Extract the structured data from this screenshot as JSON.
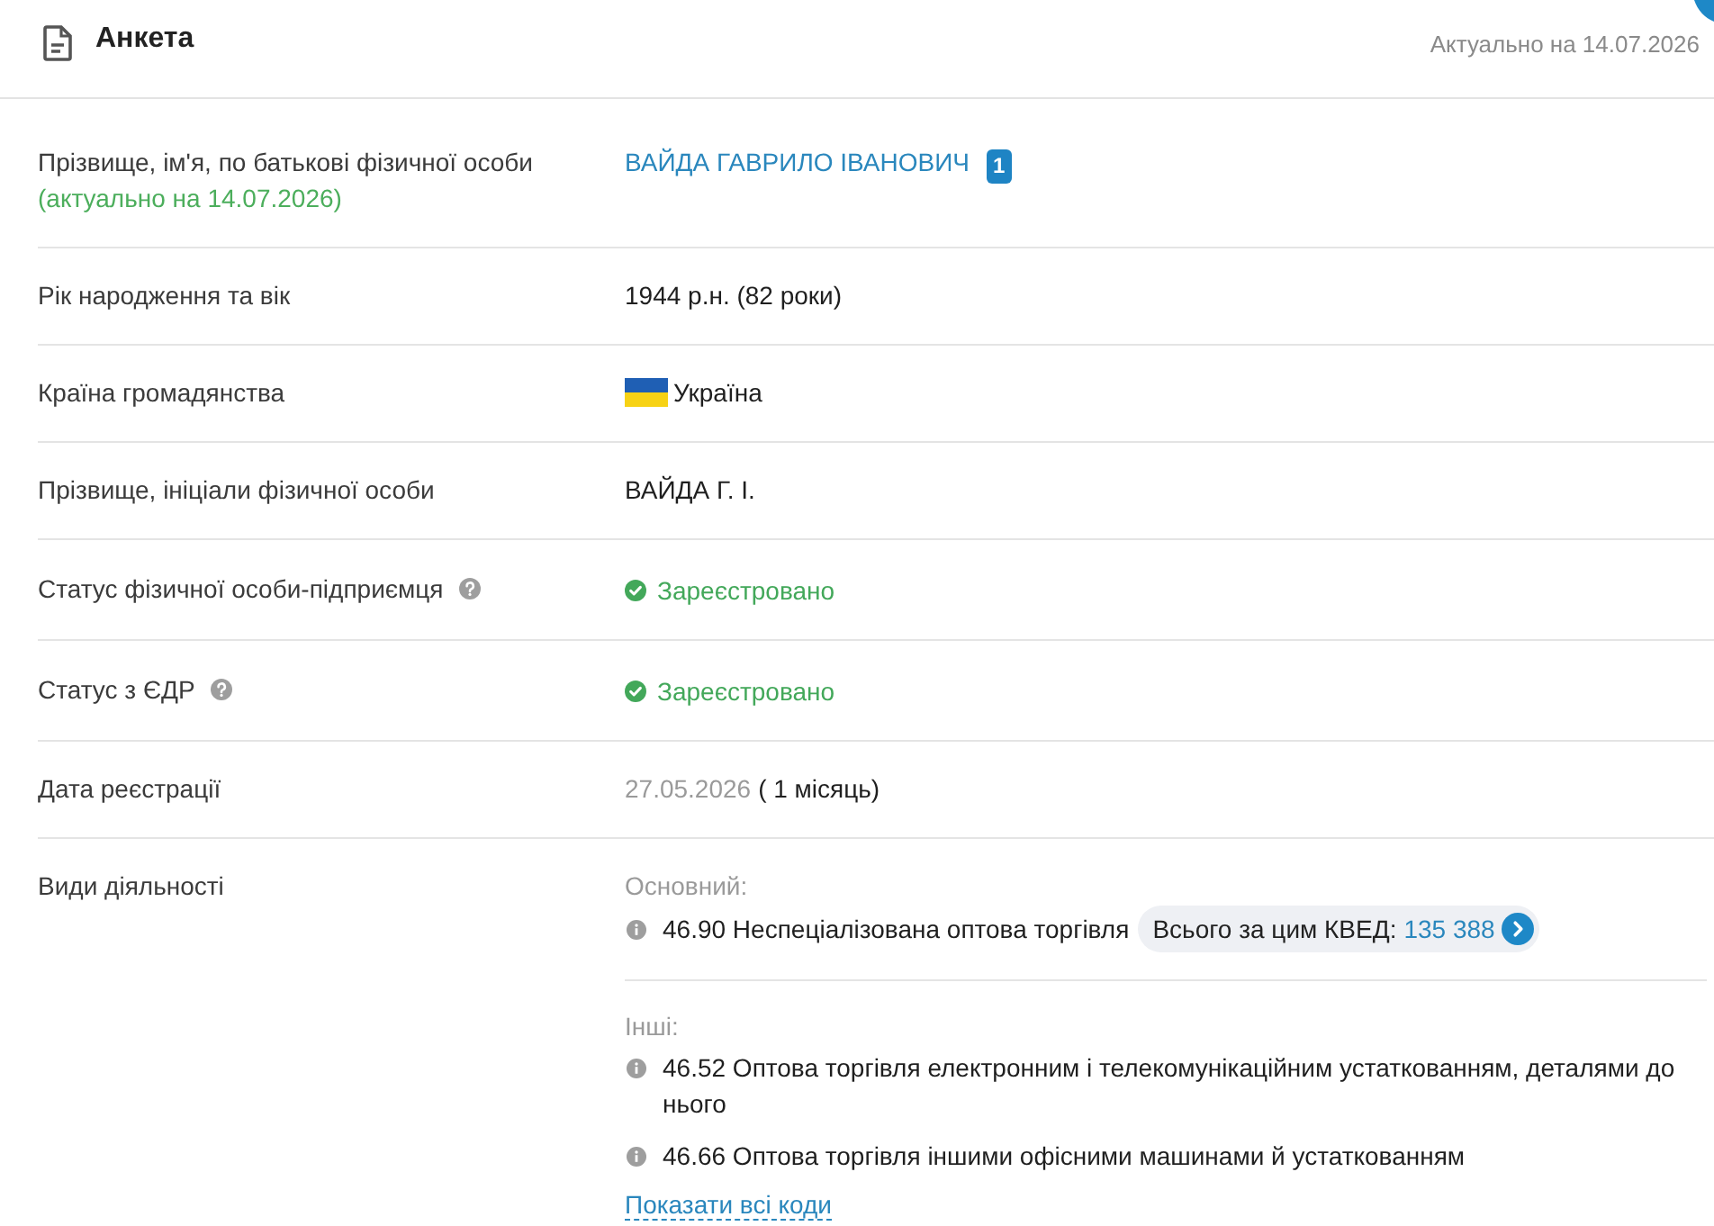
{
  "header": {
    "title": "Анкета",
    "updated": "Актуально на 14.07.2026"
  },
  "rows": [
    {
      "kind": "name",
      "label": "Прізвище, ім'я, по батькові фізичної особи",
      "note": "(актуально на 14.07.2026)",
      "value": "ВАЙДА ГАВРИЛО ІВАНОВИЧ",
      "badge": "1",
      "help": false
    },
    {
      "kind": "text",
      "label": "Рік народження та вік",
      "value": "1944 р.н. (82 роки)",
      "help": false
    },
    {
      "kind": "country",
      "label": "Країна громадянства",
      "value": "Україна",
      "help": false
    },
    {
      "kind": "text",
      "label": "Прізвище, ініціали фізичної особи",
      "value": "ВАЙДА Г. І.",
      "help": false
    },
    {
      "kind": "status",
      "label": "Статус фізичної особи-підприємця",
      "value": "Зареєстровано",
      "help": true
    },
    {
      "kind": "status",
      "label": "Статус з ЄДР",
      "value": "Зареєстровано",
      "help": true
    },
    {
      "kind": "date",
      "label": "Дата реєстрації",
      "date": "27.05.2026",
      "value": "( 1 місяць)",
      "help": false
    },
    {
      "kind": "activities",
      "label": "Види діяльності",
      "help": false,
      "main": {
        "heading": "Основний:",
        "items": [
          {
            "text": "46.90 Неспеціалізована оптова торгівля",
            "total_label": "Всього за цим КВЕД:",
            "total": "135 388"
          }
        ]
      },
      "other": {
        "heading": "Інші:",
        "items": [
          {
            "text": "46.52 Оптова торгівля електронним і телекомунікаційним устаткованням, деталями до нього"
          },
          {
            "text": "46.66 Оптова торгівля іншими офісними машинами й устаткованням"
          }
        ]
      },
      "show_all": "Показати всі коди"
    }
  ]
}
